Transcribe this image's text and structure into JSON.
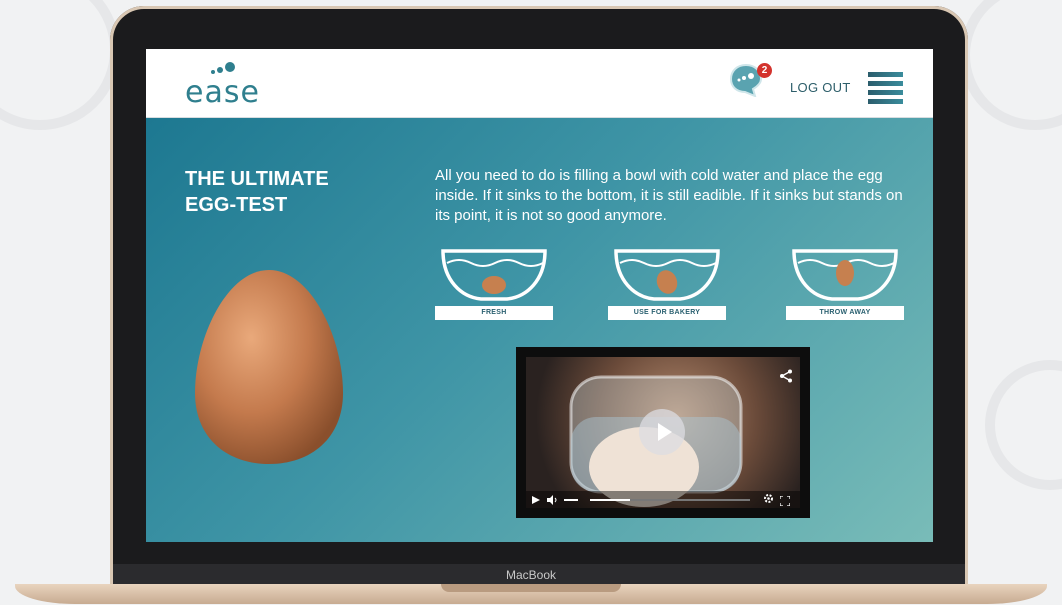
{
  "device": {
    "label": "MacBook"
  },
  "header": {
    "logo_text": "ease",
    "notification_count": "2",
    "logout_label": "LOG OUT"
  },
  "hero": {
    "title": "THE ULTIMATE\nEGG-TEST",
    "body": "All you need to do is filling a bowl with cold water and place the egg inside. If it sinks to the bottom, it is still eadible. If it sinks but stands on its point, it is not so good anymore.",
    "bowls": [
      {
        "label": "FRESH"
      },
      {
        "label": "USE FOR BAKERY"
      },
      {
        "label": "THROW AWAY"
      }
    ]
  },
  "video": {
    "progress": 0.25
  },
  "colors": {
    "brand": "#2f7f8e",
    "badge": "#d3332d",
    "hero_start": "#1d7891",
    "hero_end": "#79bcb8"
  }
}
